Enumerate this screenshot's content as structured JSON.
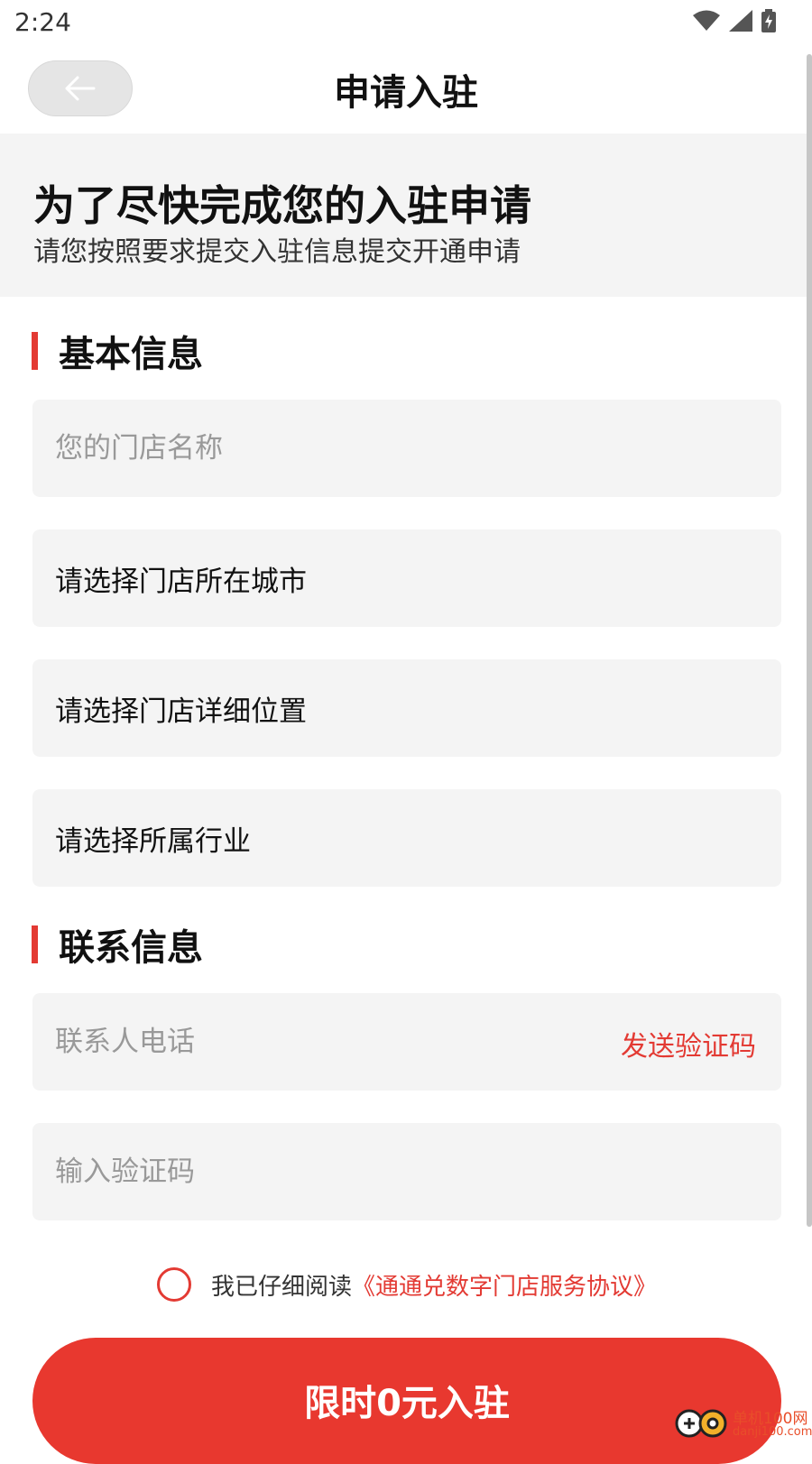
{
  "status_bar": {
    "time": "2:24"
  },
  "header": {
    "title": "申请入驻"
  },
  "intro": {
    "title": "为了尽快完成您的入驻申请",
    "subtitle": "请您按照要求提交入驻信息提交开通申请"
  },
  "basic_info": {
    "title": "基本信息",
    "store_name_placeholder": "您的门店名称",
    "city_label": "请选择门店所在城市",
    "location_label": "请选择门店详细位置",
    "industry_label": "请选择所属行业"
  },
  "contact_info": {
    "title": "联系信息",
    "phone_placeholder": "联系人电话",
    "send_code_label": "发送验证码",
    "code_placeholder": "输入验证码"
  },
  "agreement": {
    "prefix": "我已仔细阅读",
    "link": "《通通兑数字门店服务协议》"
  },
  "submit": {
    "label": "限时0元入驻"
  },
  "watermark": {
    "line1": "单机100网",
    "line2": "danji100.com"
  },
  "colors": {
    "accent": "#e8382f",
    "field_bg": "#f4f4f4",
    "intro_bg": "#f4f4f4"
  }
}
